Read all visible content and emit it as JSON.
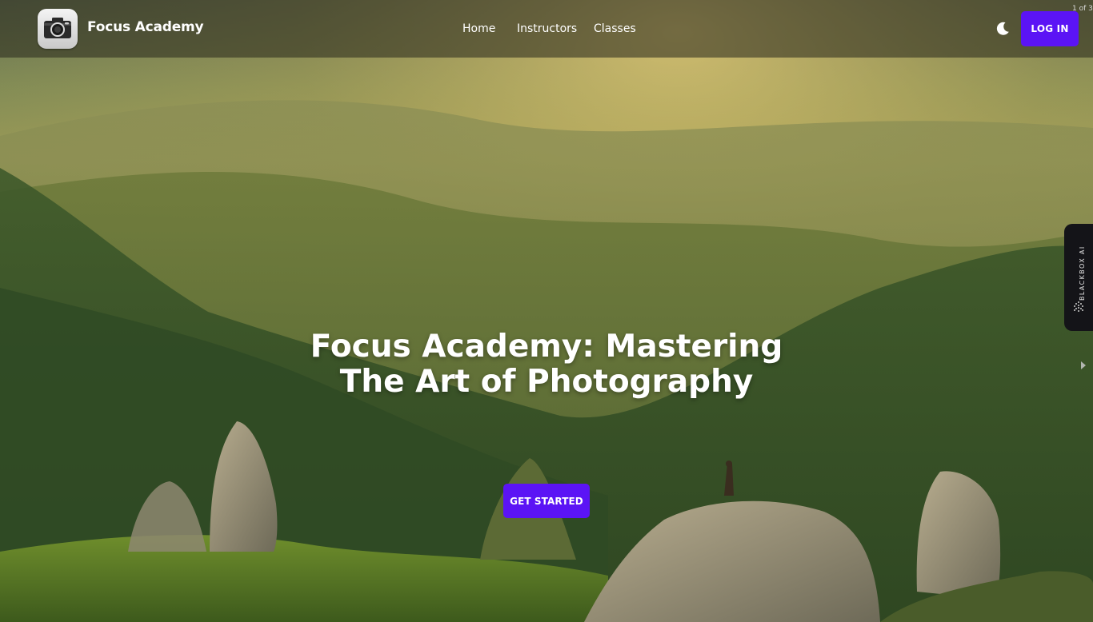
{
  "header": {
    "brand": "Focus Academy",
    "nav": [
      {
        "label": "Home"
      },
      {
        "label": "Instructors"
      },
      {
        "label": "Classes"
      }
    ],
    "login_label": "LOG IN",
    "theme_icon": "moon-icon",
    "logo_icon": "camera-icon"
  },
  "hero": {
    "headline_line1": "Focus Academy: Mastering",
    "headline_line2": "The Art of Photography",
    "cta_label": "GET STARTED"
  },
  "overlay": {
    "page_counter": "1 of 3",
    "side_tab_label": "BLACKBOX AI"
  },
  "colors": {
    "accent": "#5b14f5",
    "nav_bg": "rgba(40, 40, 28, 0.55)",
    "side_tab_bg": "#141418"
  }
}
